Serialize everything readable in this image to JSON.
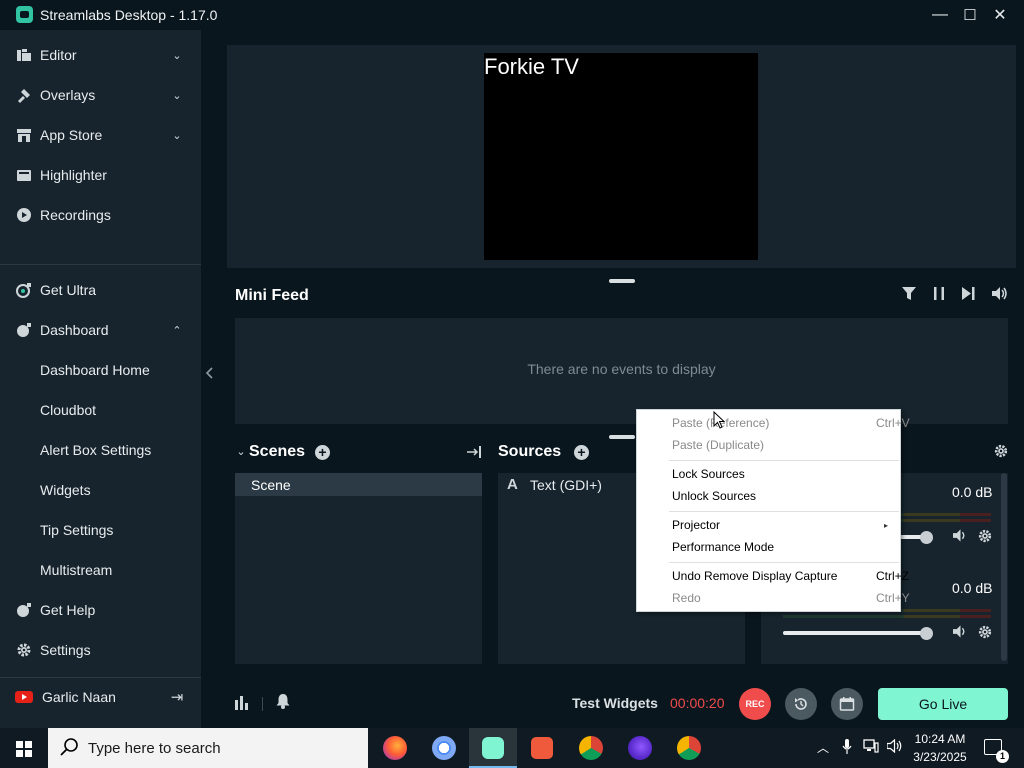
{
  "window": {
    "title": "Streamlabs Desktop - 1.17.0",
    "minimize": "—",
    "maximize": "☐",
    "close": "✕"
  },
  "sidebar": {
    "items": [
      {
        "label": "Editor",
        "icon": "editor-icon",
        "chevron": "⌄"
      },
      {
        "label": "Overlays",
        "icon": "overlays-icon",
        "chevron": "⌄"
      },
      {
        "label": "App Store",
        "icon": "store-icon",
        "chevron": "⌄"
      },
      {
        "label": "Highlighter",
        "icon": "highlighter-icon"
      },
      {
        "label": "Recordings",
        "icon": "recordings-icon"
      }
    ],
    "get_ultra": "Get Ultra",
    "dashboard": "Dashboard",
    "dashboard_chevron": "⌃",
    "dashboard_items": [
      "Dashboard Home",
      "Cloudbot",
      "Alert Box Settings",
      "Widgets",
      "Tip Settings",
      "Multistream"
    ],
    "get_help": "Get Help",
    "settings": "Settings",
    "user": "Garlic Naan",
    "logout_glyph": "⇥"
  },
  "preview": {
    "text": "Forkie TV"
  },
  "mini_feed": {
    "title": "Mini Feed",
    "empty": "There are no events to display"
  },
  "scenes": {
    "title": "Scenes",
    "items": [
      "Scene"
    ]
  },
  "sources": {
    "title": "Sources",
    "items": [
      {
        "icon": "A",
        "label": "Text (GDI+)"
      }
    ]
  },
  "mixer": {
    "channels": [
      {
        "db": "0.0 dB",
        "level": 1.0
      },
      {
        "db": "0.0 dB",
        "level": 1.0
      }
    ]
  },
  "context_menu": {
    "items": [
      {
        "label": "Paste (Reference)",
        "shortcut": "Ctrl+V",
        "disabled": true
      },
      {
        "label": "Paste (Duplicate)",
        "shortcut": "",
        "disabled": true
      },
      {
        "label": "Lock Sources",
        "shortcut": "",
        "disabled": false
      },
      {
        "label": "Unlock Sources",
        "shortcut": "",
        "disabled": false
      },
      {
        "label": "Projector",
        "shortcut": "",
        "disabled": false,
        "submenu": "▸"
      },
      {
        "label": "Performance Mode",
        "shortcut": "",
        "disabled": false
      },
      {
        "label": "Undo Remove Display Capture",
        "shortcut": "Ctrl+Z",
        "disabled": false
      },
      {
        "label": "Redo",
        "shortcut": "Ctrl+Y",
        "disabled": true
      }
    ]
  },
  "footer": {
    "test_widgets": "Test Widgets",
    "timer": "00:00:20",
    "rec": "REC",
    "go_live": "Go Live"
  },
  "taskbar": {
    "search_placeholder": "Type here to search",
    "time": "10:24 AM",
    "date": "3/23/2025",
    "notifications": "1"
  },
  "colors": {
    "accent": "#80f5d2",
    "rec": "#f04c4c",
    "panel": "#17242d",
    "background": "#09161d"
  }
}
